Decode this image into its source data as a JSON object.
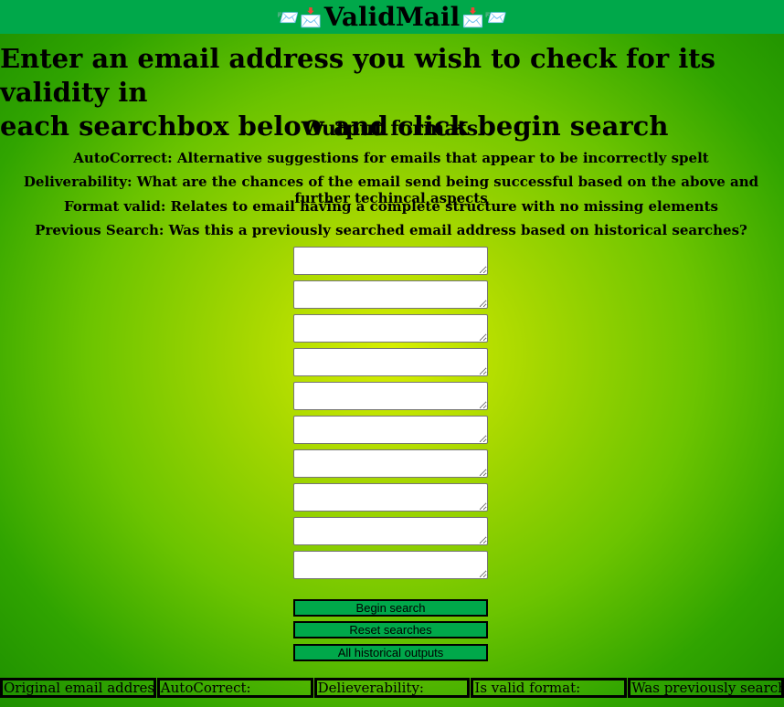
{
  "header": {
    "title": "ValidMail",
    "left_icon": "📨📩",
    "right_icon": "📩📨"
  },
  "intro": {
    "line1": "Enter an email address you wish to check for its validity in",
    "line2": "each searchbox below and click begin search"
  },
  "formats": {
    "heading": "Output formats",
    "items": [
      "AutoCorrect: Alternative suggestions for emails that appear to be incorrectly spelt",
      "Deliverability: What are the chances of the email send being successful based on the above and further techincal aspects",
      "Format valid: Relates to email having a complete structure with no missing elements",
      "Previous Search: Was this a previously searched email address based on historical searches?"
    ]
  },
  "search_boxes": {
    "values": [
      "",
      "",
      "",
      "",
      "",
      "",
      "",
      "",
      "",
      ""
    ]
  },
  "buttons": {
    "begin": "Begin search",
    "reset": "Reset searches",
    "history": "All historical outputs"
  },
  "results": {
    "columns": [
      "Original email address:",
      "AutoCorrect:",
      "Delieverability:",
      "Is valid format:",
      "Was previously searched:"
    ]
  },
  "colors": {
    "header_bg": "#00a84a",
    "button_bg": "#00a84a",
    "gradient_center": "#d8ef00",
    "gradient_edge": "#1e9000"
  }
}
